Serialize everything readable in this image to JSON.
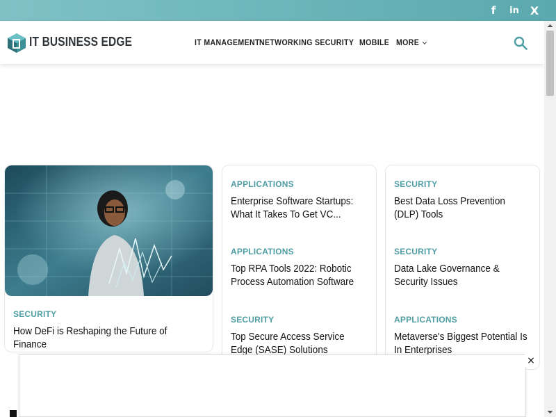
{
  "social": {
    "facebook_glyph": "f",
    "linkedin_glyph": "in",
    "x_glyph": "X"
  },
  "header": {
    "logo_text": "IT BUSINESS EDGE",
    "nav": [
      {
        "label": "IT MANAGEMENT"
      },
      {
        "label": "NETWORKING"
      },
      {
        "label": "SECURITY"
      },
      {
        "label": "MOBILE"
      },
      {
        "label": "MORE"
      }
    ]
  },
  "featured": {
    "category": "SECURITY",
    "title": "How DeFi is Reshaping the Future of Finance"
  },
  "column1": [
    {
      "category": "APPLICATIONS",
      "title": "Enterprise Software Startups: What It Takes To Get VC..."
    },
    {
      "category": "APPLICATIONS",
      "title": "Top RPA Tools 2022: Robotic Process Automation Software"
    },
    {
      "category": "SECURITY",
      "title": "Top Secure Access Service Edge (SASE) Solutions"
    }
  ],
  "column2": [
    {
      "category": "SECURITY",
      "title": "Best Data Loss Prevention (DLP) Tools"
    },
    {
      "category": "SECURITY",
      "title": "Data Lake Governance & Security Issues"
    },
    {
      "category": "APPLICATIONS",
      "title": "Metaverse's Biggest Potential Is In Enterprises"
    }
  ],
  "ad": {
    "close_glyph": "×"
  },
  "colors": {
    "accent": "#4f9ea3",
    "topbar": "#6bb5b9",
    "logo_dark": "#2f3b46"
  }
}
